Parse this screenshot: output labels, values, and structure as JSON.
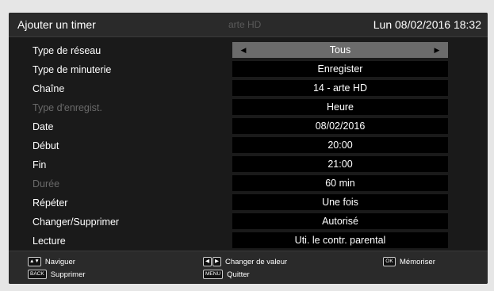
{
  "header": {
    "title": "Ajouter un timer",
    "channel": "arte HD",
    "datetime": "Lun 08/02/2016 18:32"
  },
  "rows": [
    {
      "label": "Type de réseau",
      "value": "Tous",
      "selected": true,
      "enabled": true
    },
    {
      "label": "Type de minuterie",
      "value": "Enregister",
      "selected": false,
      "enabled": true
    },
    {
      "label": "Chaîne",
      "value": "14 - arte HD",
      "selected": false,
      "enabled": true
    },
    {
      "label": "Type d'enregist.",
      "value": "Heure",
      "selected": false,
      "enabled": false
    },
    {
      "label": "Date",
      "value": "08/02/2016",
      "selected": false,
      "enabled": true
    },
    {
      "label": "Début",
      "value": "20:00",
      "selected": false,
      "enabled": true
    },
    {
      "label": "Fin",
      "value": "21:00",
      "selected": false,
      "enabled": true
    },
    {
      "label": "Durée",
      "value": "60 min",
      "selected": false,
      "enabled": false
    },
    {
      "label": "Répéter",
      "value": "Une fois",
      "selected": false,
      "enabled": true
    },
    {
      "label": "Changer/Supprimer",
      "value": "Autorisé",
      "selected": false,
      "enabled": true
    },
    {
      "label": "Lecture",
      "value": "Uti. le contr. parental",
      "selected": false,
      "enabled": true
    }
  ],
  "footer": {
    "navigate": {
      "key": "▲▼",
      "label": "Naviguer"
    },
    "delete": {
      "key": "BACK",
      "label": "Supprimer"
    },
    "change": {
      "key_left": "◀",
      "key_right": "▶",
      "label": "Changer de valeur"
    },
    "quit": {
      "key": "MENU",
      "label": "Quitter"
    },
    "save": {
      "key": "OK",
      "label": "Mémoriser"
    }
  },
  "colors": {
    "panel_bg": "#1a1a1a",
    "selected_row": "#6b6b6b",
    "value_bg": "#000000",
    "disabled_text": "#6a6a6a"
  }
}
